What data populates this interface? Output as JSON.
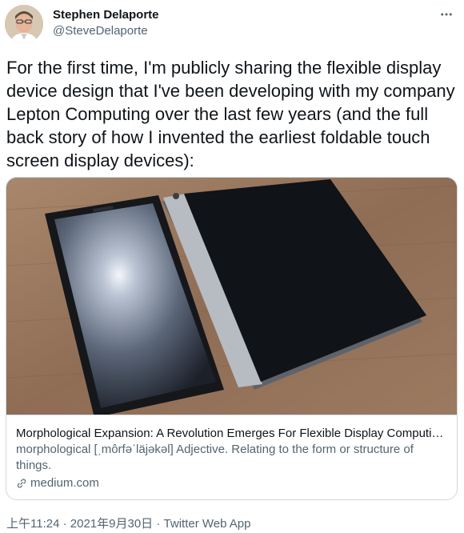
{
  "author": {
    "display_name": "Stephen Delaporte",
    "handle": "@SteveDelaporte",
    "avatar_icon": "user-avatar"
  },
  "tweet": {
    "text": "For the first time, I'm publicly sharing the flexible display device design that I've been developing with my company Lepton Computing over the last few years (and the full back story of how I invented the earliest foldable touch screen display devices):"
  },
  "card": {
    "title": "Morphological Expansion: A Revolution Emerges For Flexible Display Computin…",
    "description": "morphological [ˌmôrfəˈläjəkəl] Adjective. Relating to the form or structure of things.",
    "domain": "medium.com",
    "link_icon": "link-icon"
  },
  "meta": {
    "time": "上午11:24",
    "separator": "·",
    "date": "2021年9月30日",
    "source": "Twitter Web App"
  },
  "colors": {
    "text_primary": "#0f1419",
    "text_secondary": "#536471",
    "border": "#cfd9de"
  }
}
